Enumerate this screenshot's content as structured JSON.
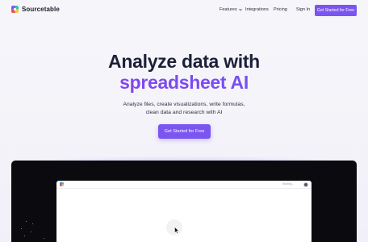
{
  "brand": {
    "name": "Sourcetable"
  },
  "nav": {
    "features": "Features",
    "integrations": "Integrations",
    "pricing": "Pricing",
    "sign_in": "Sign In",
    "cta": "Get Started for Free"
  },
  "hero": {
    "title_line1": "Analyze data with",
    "title_line2": "spreadsheet AI",
    "subtitle_line1": "Analyze files, create visualizations, write formulas,",
    "subtitle_line2": "clean data and research with AI",
    "cta": "Get Started for Free"
  },
  "demo": {
    "status": "Waiting..."
  },
  "colors": {
    "accent": "#7a55f0",
    "title": "#1c2138",
    "demo_bg": "#0b0b0f"
  },
  "icons": {
    "logo": "sourcetable-logo-icon",
    "features_dropdown": "chevron-down-icon",
    "cursor": "mouse-pointer-icon",
    "avatar": "user-avatar-icon"
  }
}
